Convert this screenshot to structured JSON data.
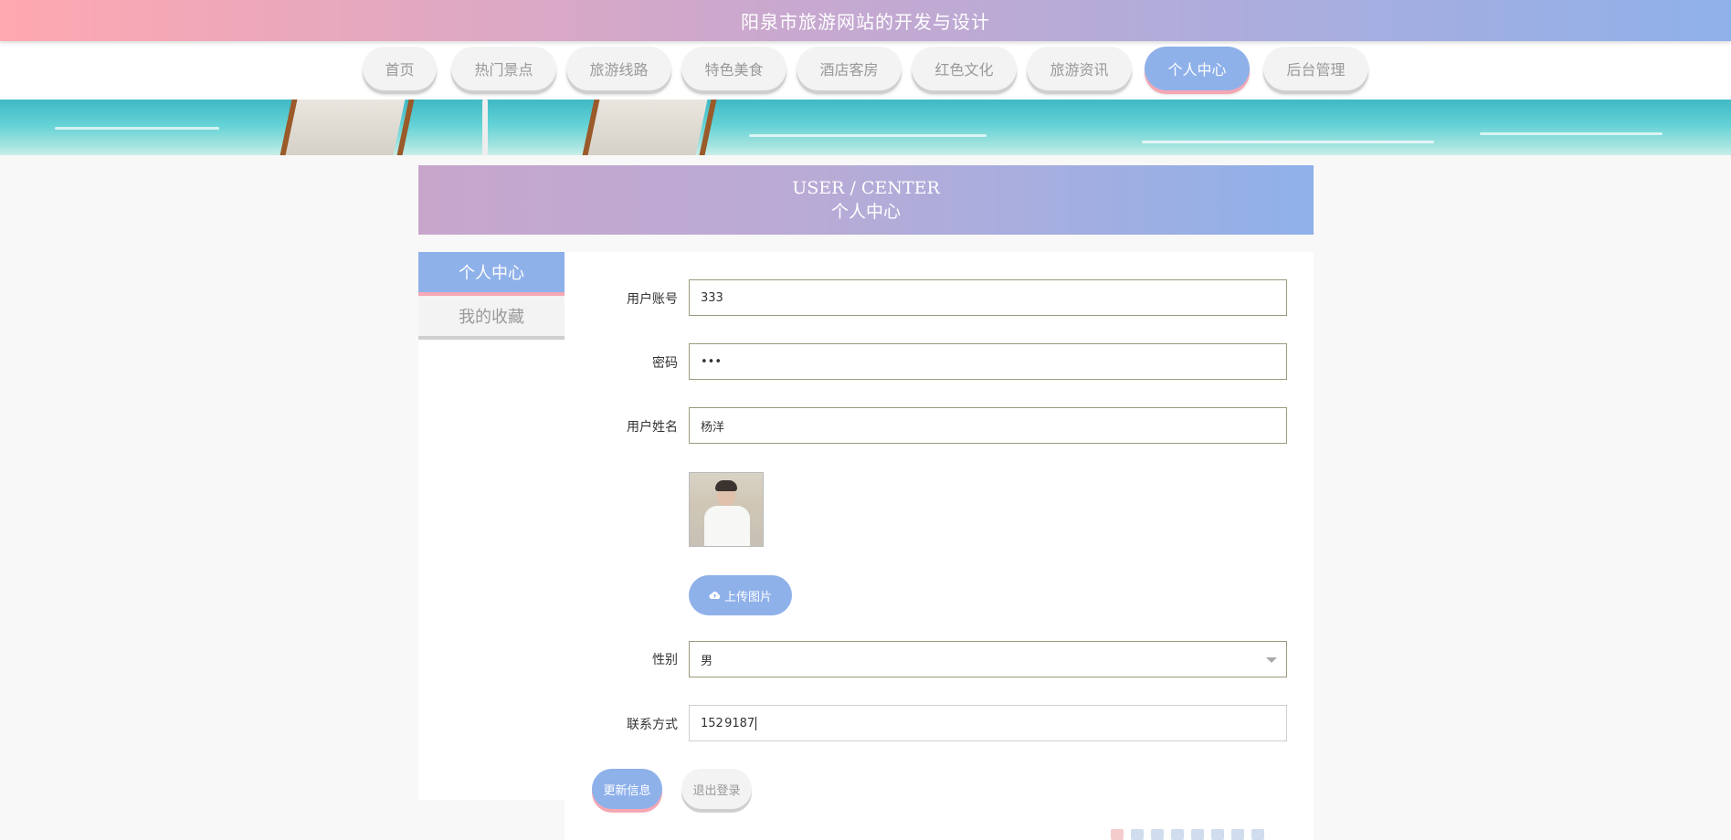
{
  "site": {
    "title": "阳泉市旅游网站的开发与设计"
  },
  "nav": {
    "items": [
      {
        "label": "首页"
      },
      {
        "label": "热门景点"
      },
      {
        "label": "旅游线路"
      },
      {
        "label": "特色美食"
      },
      {
        "label": "酒店客房"
      },
      {
        "label": "红色文化"
      },
      {
        "label": "旅游资讯"
      },
      {
        "label": "个人中心"
      },
      {
        "label": "后台管理"
      }
    ],
    "active": "个人中心"
  },
  "section": {
    "title_en": "USER / CENTER",
    "title_cn": "个人中心"
  },
  "sidebar": {
    "items": [
      {
        "label": "个人中心"
      },
      {
        "label": "我的收藏"
      }
    ]
  },
  "form": {
    "account": {
      "label": "用户账号",
      "value": "333"
    },
    "password": {
      "label": "密码",
      "value": "•••"
    },
    "name": {
      "label": "用户姓名",
      "value": "杨洋"
    },
    "upload_label": "上传图片",
    "gender": {
      "label": "性别",
      "value": "男"
    },
    "contact": {
      "label": "联系方式",
      "value": "152 9187"
    }
  },
  "actions": {
    "update": "更新信息",
    "logout": "退出登录"
  },
  "colors": {
    "accent": "#8fb1ea",
    "pink": "#f5a7b3",
    "gradient_start": "#ffa8b0"
  }
}
